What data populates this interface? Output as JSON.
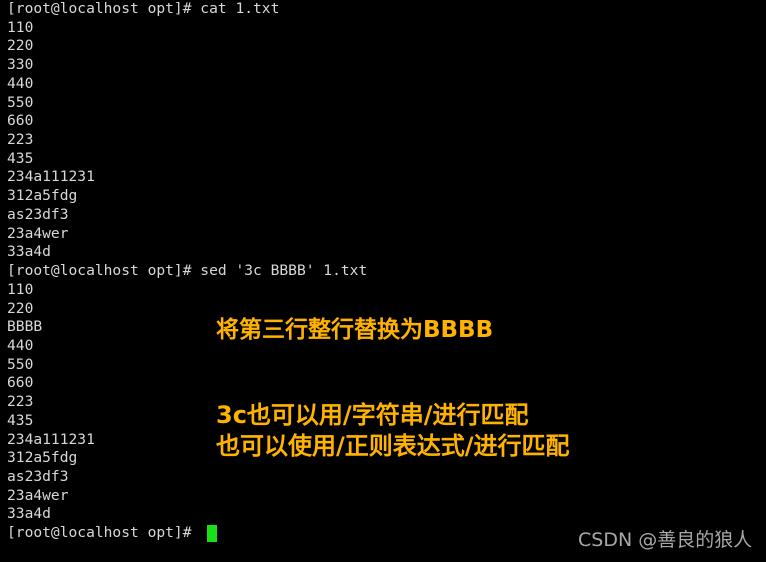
{
  "terminal": {
    "background_color": "#000000",
    "text_color": "#d8d8d8",
    "cursor_color": "#17e017",
    "lines": [
      "[root@localhost opt]# cat 1.txt",
      "110",
      "220",
      "330",
      "440",
      "550",
      "660",
      "223",
      "435",
      "234a111231",
      "312a5fdg",
      "as23df3",
      "23a4wer",
      "33a4d",
      "[root@localhost opt]# sed '3c BBBB' 1.txt",
      "110",
      "220",
      "BBBB",
      "440",
      "550",
      "660",
      "223",
      "435",
      "234a111231",
      "312a5fdg",
      "as23df3",
      "23a4wer",
      "33a4d"
    ],
    "final_prompt": "[root@localhost opt]# "
  },
  "annotations": {
    "color": "#ffb300",
    "line1": "将第三行整行替换为BBBB",
    "line2": "3c也可以用/字符串/进行匹配",
    "line3": "也可以使用/正则表达式/进行匹配"
  },
  "watermark": {
    "text": "CSDN @善良的狼人",
    "color": "#a8a8a8"
  }
}
